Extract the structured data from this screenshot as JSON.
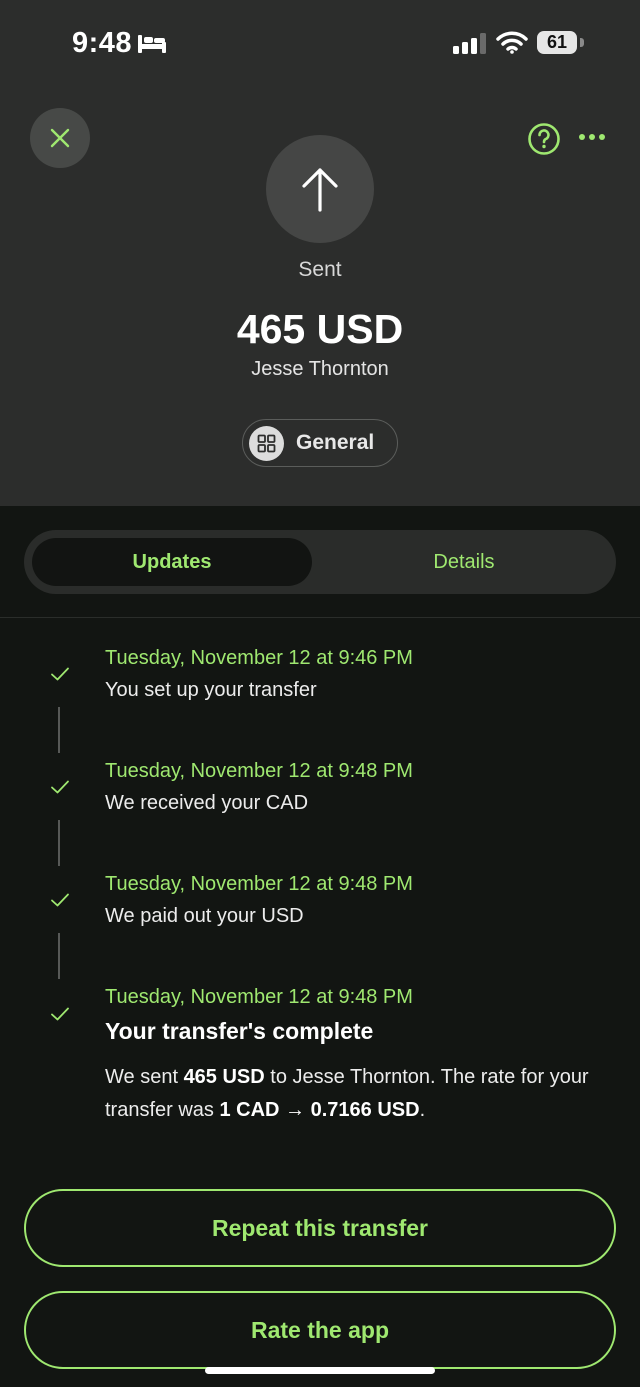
{
  "status_bar": {
    "time": "9:48",
    "battery": "61"
  },
  "header": {
    "status_label": "Sent",
    "amount": "465 USD",
    "recipient": "Jesse Thornton",
    "category": "General"
  },
  "tabs": [
    {
      "label": "Updates",
      "selected": true
    },
    {
      "label": "Details",
      "selected": false
    }
  ],
  "timeline": [
    {
      "date": "Tuesday, November 12 at 9:46 PM",
      "text": "You set up your transfer"
    },
    {
      "date": "Tuesday, November 12 at 9:48 PM",
      "text": "We received your CAD"
    },
    {
      "date": "Tuesday, November 12 at 9:48 PM",
      "text": "We paid out your USD"
    },
    {
      "date": "Tuesday, November 12 at 9:48 PM",
      "title": "Your transfer's complete",
      "desc_1": "We sent ",
      "desc_amount": "465 USD",
      "desc_2": " to Jesse Thornton. The rate for your transfer was ",
      "desc_rate": "1 CAD → 0.7166 USD",
      "desc_3": "."
    }
  ],
  "actions": {
    "repeat_label": "Repeat this transfer",
    "rate_label": "Rate the app"
  },
  "colors": {
    "accent": "#9fe870",
    "header_bg": "#2c2d2c",
    "body_bg": "#121512"
  },
  "icons": [
    "bed-icon",
    "signal-icon",
    "wifi-icon",
    "close-icon",
    "help-icon",
    "more-icon",
    "arrow-up-icon",
    "grid-icon",
    "check-icon"
  ]
}
